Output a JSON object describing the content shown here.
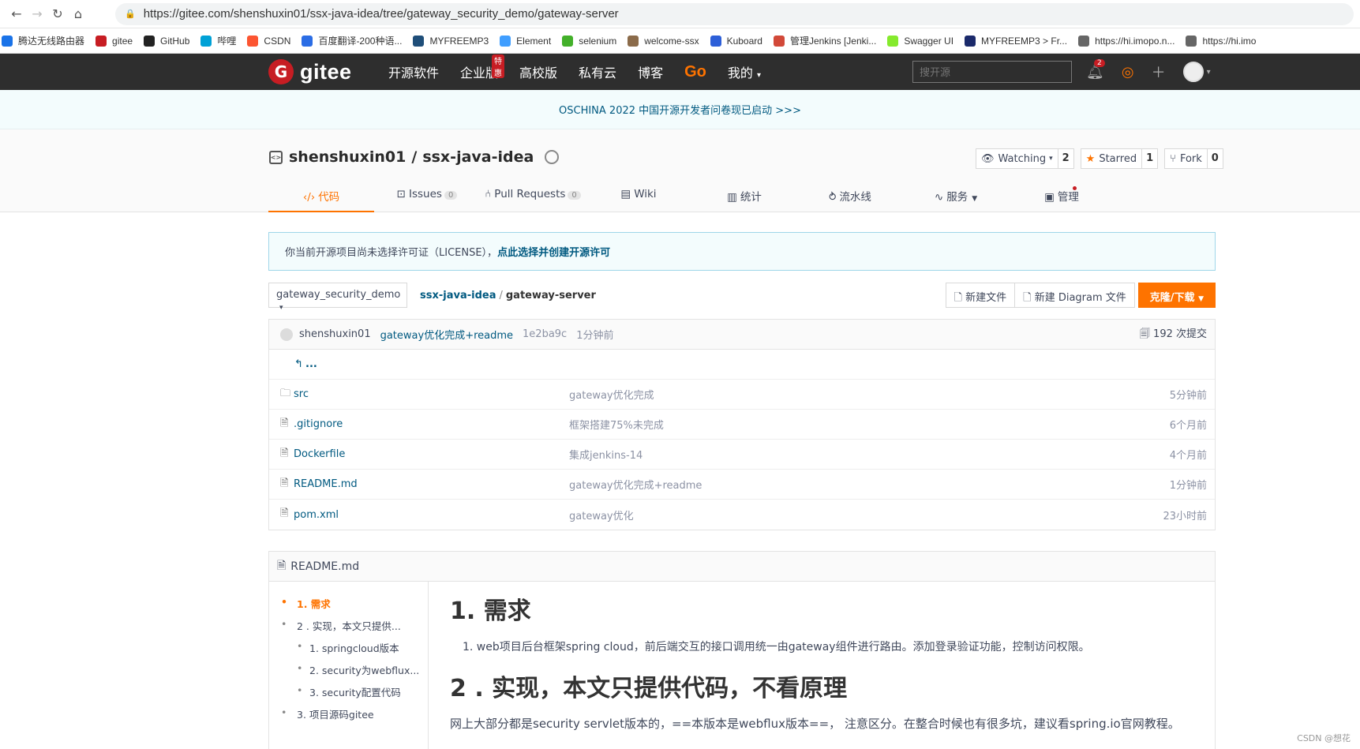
{
  "browser": {
    "url": "https://gitee.com/shenshuxin01/ssx-java-idea/tree/gateway_security_demo/gateway-server",
    "bookmarks": [
      {
        "label": "腾达无线路由器",
        "icon": "tp-icon",
        "color": "#1a73e8"
      },
      {
        "label": "gitee",
        "icon": "gitee-icon",
        "color": "#c71d23"
      },
      {
        "label": "GitHub",
        "icon": "github-icon",
        "color": "#222222"
      },
      {
        "label": "哔哩",
        "icon": "bilibili-icon",
        "color": "#00a1d6"
      },
      {
        "label": "CSDN",
        "icon": "csdn-icon",
        "color": "#fc5531"
      },
      {
        "label": "百度翻译-200种语...",
        "icon": "translate-icon",
        "color": "#2b6de5"
      },
      {
        "label": "MYFREEMP3",
        "icon": "music-icon",
        "color": "#1f4e79"
      },
      {
        "label": "Element",
        "icon": "element-icon",
        "color": "#409eff"
      },
      {
        "label": "selenium",
        "icon": "selenium-icon",
        "color": "#43b02a"
      },
      {
        "label": "welcome-ssx",
        "icon": "image-icon",
        "color": "#8b6b4a"
      },
      {
        "label": "Kuboard",
        "icon": "kuboard-icon",
        "color": "#2d5fd8"
      },
      {
        "label": "管理Jenkins [Jenki...",
        "icon": "jenkins-icon",
        "color": "#d24939"
      },
      {
        "label": "Swagger UI",
        "icon": "swagger-icon",
        "color": "#85ea2d"
      },
      {
        "label": "MYFREEMP3 > Fr...",
        "icon": "m-icon",
        "color": "#1b2a6b"
      },
      {
        "label": "https://hi.imopo.n...",
        "icon": "globe-icon",
        "color": "#666666"
      },
      {
        "label": "https://hi.imo",
        "icon": "globe-icon",
        "color": "#666666"
      }
    ]
  },
  "header": {
    "logo": "gitee",
    "nav": [
      "开源软件",
      "企业版",
      "高校版",
      "私有云",
      "博客",
      "Go",
      "我的"
    ],
    "hot_badge": "特惠",
    "search_placeholder": "搜开源",
    "notification_count": "2"
  },
  "banner": {
    "text": "OSCHINA 2022 中国开源开发者问卷现已启动 >>>"
  },
  "project": {
    "owner": "shenshuxin01",
    "separator": "/",
    "name": "ssx-java-idea",
    "watch": {
      "label": "Watching",
      "count": "2"
    },
    "star": {
      "label": "Starred",
      "count": "1"
    },
    "fork": {
      "label": "Fork",
      "count": "0"
    },
    "tabs": [
      {
        "label": "代码",
        "icon": "code-icon"
      },
      {
        "label": "Issues",
        "icon": "issues-icon",
        "count": "0"
      },
      {
        "label": "Pull Requests",
        "icon": "pr-icon",
        "count": "0"
      },
      {
        "label": "Wiki",
        "icon": "wiki-icon"
      },
      {
        "label": "统计",
        "icon": "stats-icon"
      },
      {
        "label": "流水线",
        "icon": "pipeline-icon"
      },
      {
        "label": "服务",
        "icon": "service-icon"
      },
      {
        "label": "管理",
        "icon": "manage-icon"
      }
    ]
  },
  "license": {
    "text": "你当前开源项目尚未选择许可证（LICENSE），",
    "link": "点此选择并创建开源许可"
  },
  "toolbar": {
    "branch": "gateway_security_demo",
    "crumb_root": "ssx-java-idea",
    "crumb_sep": "/",
    "crumb_current": "gateway-server",
    "new_file": "新建文件",
    "new_diagram": "新建 Diagram 文件",
    "clone": "克隆/下载"
  },
  "commit": {
    "author": "shenshuxin01",
    "message": "gateway优化完成+readme",
    "sha": "1e2ba9c",
    "time": "1分钟前",
    "count": "192 次提交"
  },
  "files": {
    "up": "...",
    "rows": [
      {
        "name": "src",
        "type": "folder",
        "message": "gateway优化完成",
        "time": "5分钟前"
      },
      {
        "name": ".gitignore",
        "type": "file",
        "message": "框架搭建75%未完成",
        "time": "6个月前"
      },
      {
        "name": "Dockerfile",
        "type": "file",
        "message": "集成jenkins-14",
        "time": "4个月前"
      },
      {
        "name": "README.md",
        "type": "file",
        "message": "gateway优化完成+readme",
        "time": "1分钟前"
      },
      {
        "name": "pom.xml",
        "type": "file",
        "message": "gateway优化",
        "time": "23小时前"
      }
    ]
  },
  "readme": {
    "title": "README.md",
    "toc": [
      {
        "label": "1. 需求",
        "level": 1
      },
      {
        "label": "2 . 实现，本文只提供...",
        "level": 1
      },
      {
        "label": "1. springcloud版本",
        "level": 2
      },
      {
        "label": "2. security为webflux...",
        "level": 2
      },
      {
        "label": "3. security配置代码",
        "level": 2
      },
      {
        "label": "3. 项目源码gitee",
        "level": 1
      }
    ],
    "h1": "1. 需求",
    "item1": "1. web项目后台框架spring cloud，前后端交互的接口调用统一由gateway组件进行路由。添加登录验证功能，控制访问权限。",
    "h2": "2 . 实现，本文只提供代码，不看原理",
    "para": "网上大部分都是security servlet版本的，==本版本是webflux版本==， 注意区分。在整合时候也有很多坑，建议看spring.io官网教程。"
  },
  "watermark": "CSDN @想花"
}
